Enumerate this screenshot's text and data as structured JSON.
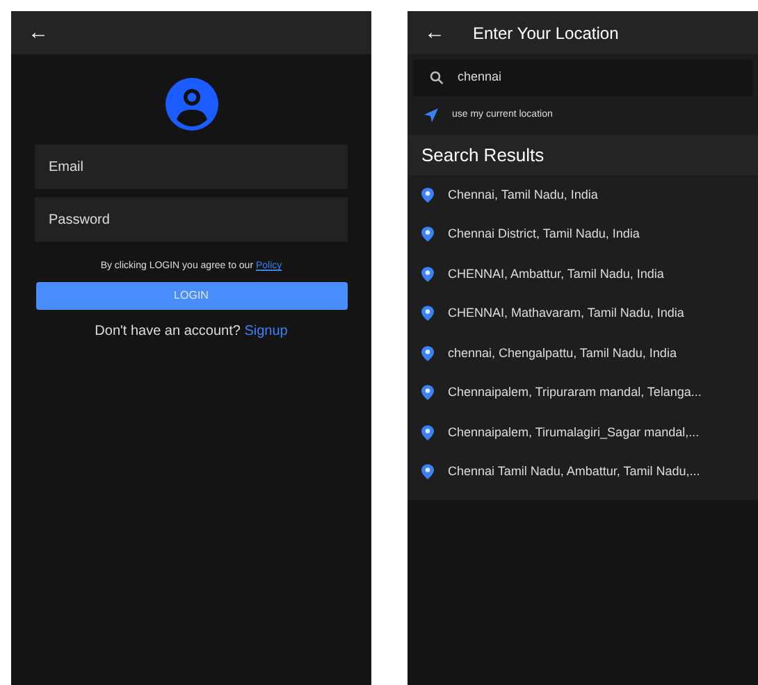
{
  "login_screen": {
    "back": "←",
    "email": {
      "placeholder": "Email"
    },
    "password": {
      "placeholder": "Password"
    },
    "policy_text": "By clicking LOGIN you agree to our",
    "policy_link": "Policy",
    "login_button": "LOGIN",
    "signup_prompt": "Don't have an account?",
    "signup_link": "Signup"
  },
  "location_screen": {
    "back": "←",
    "title": "Enter Your Location",
    "search": {
      "value": "chennai"
    },
    "current_location": "use my current location",
    "results_heading": "Search Results",
    "results": [
      "Chennai, Tamil Nadu, India",
      "Chennai District, Tamil Nadu, India",
      "CHENNAI, Ambattur, Tamil Nadu, India",
      "CHENNAI, Mathavaram, Tamil Nadu, India",
      "chennai, Chengalpattu, Tamil Nadu, India",
      "Chennaipalem, Tripuraram mandal, Telanga...",
      "Chennaipalem, Tirumalagiri_Sagar mandal,...",
      "Chennai Tamil Nadu, Ambattur, Tamil Nadu,..."
    ]
  }
}
